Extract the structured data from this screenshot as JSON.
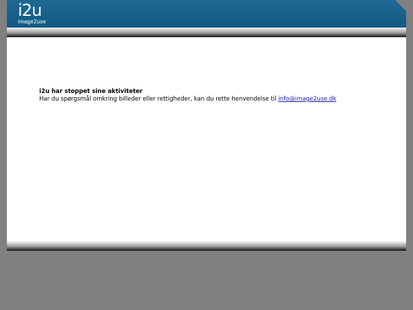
{
  "header": {
    "logo_main": "i2u",
    "logo_sub": "image2use"
  },
  "colors": {
    "header_blue": "#0f5a84",
    "background_gray": "#808080",
    "link": "#1a1aa6"
  },
  "message": {
    "title": "i2u har stoppet sine aktiviteter",
    "body": "Har du spørgsmål omkring billeder eller rettigheder, kan du rette henvendelse til ",
    "email_link": "info@image2use.dk"
  }
}
